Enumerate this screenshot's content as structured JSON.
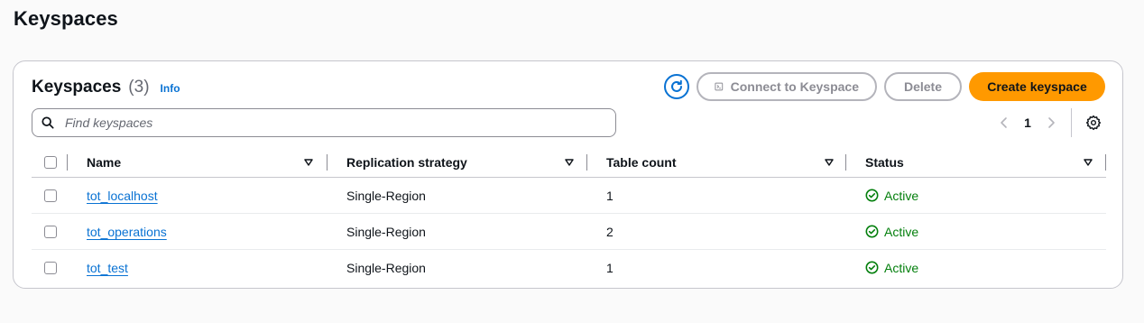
{
  "page": {
    "title": "Keyspaces"
  },
  "panel": {
    "title": "Keyspaces",
    "count": "(3)",
    "info": "Info",
    "actions": {
      "connect": "Connect to Keyspace",
      "delete": "Delete",
      "create": "Create keyspace"
    },
    "search": {
      "placeholder": "Find keyspaces",
      "value": ""
    },
    "pagination": {
      "current_page": "1"
    }
  },
  "table": {
    "columns": [
      "Name",
      "Replication strategy",
      "Table count",
      "Status"
    ],
    "rows": [
      {
        "name": "tot_localhost",
        "replication": "Single-Region",
        "table_count": "1",
        "status": "Active"
      },
      {
        "name": "tot_operations",
        "replication": "Single-Region",
        "table_count": "2",
        "status": "Active"
      },
      {
        "name": "tot_test",
        "replication": "Single-Region",
        "table_count": "1",
        "status": "Active"
      }
    ]
  },
  "colors": {
    "accent": "#0972d3",
    "primary_button": "#ff9900",
    "status_success": "#037f0c",
    "disabled": "#8c8c94"
  },
  "icons": {
    "refresh": "refresh-icon",
    "connect": "terminal-icon",
    "search": "search-icon",
    "prev": "chevron-left-icon",
    "next": "chevron-right-icon",
    "settings": "gear-icon",
    "sort": "caret-down-icon",
    "status": "check-circle-icon"
  }
}
